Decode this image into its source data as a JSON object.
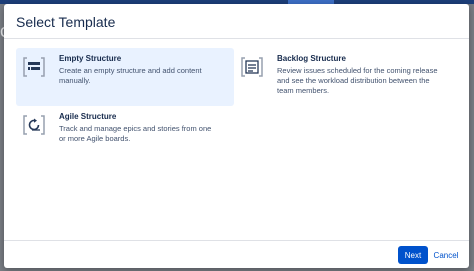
{
  "dialog": {
    "title": "Select Template"
  },
  "templates": [
    {
      "title": "Empty Structure",
      "description_lines": [
        "Create an empty structure and add content",
        "manually."
      ],
      "icon": "empty-structure-icon",
      "selected": true
    },
    {
      "title": "Backlog Structure",
      "description_lines": [
        "Review issues scheduled for the coming release",
        "and see the workload distribution between the",
        "team members."
      ],
      "icon": "backlog-structure-icon",
      "selected": false
    },
    {
      "title": "Agile Structure",
      "description_lines": [
        "Track and manage epics and stories from one",
        "or more Agile boards."
      ],
      "icon": "agile-structure-icon",
      "selected": false
    }
  ],
  "footer": {
    "next_label": "Next",
    "cancel_label": "Cancel"
  },
  "background": {
    "partial_heading": "c"
  },
  "colors": {
    "primary": "#0052cc",
    "selected_bg": "#e9f2ff",
    "title_text": "#172b4d",
    "body_text": "#42526e",
    "icon_gray": "#97a0af",
    "icon_navy": "#253858"
  }
}
